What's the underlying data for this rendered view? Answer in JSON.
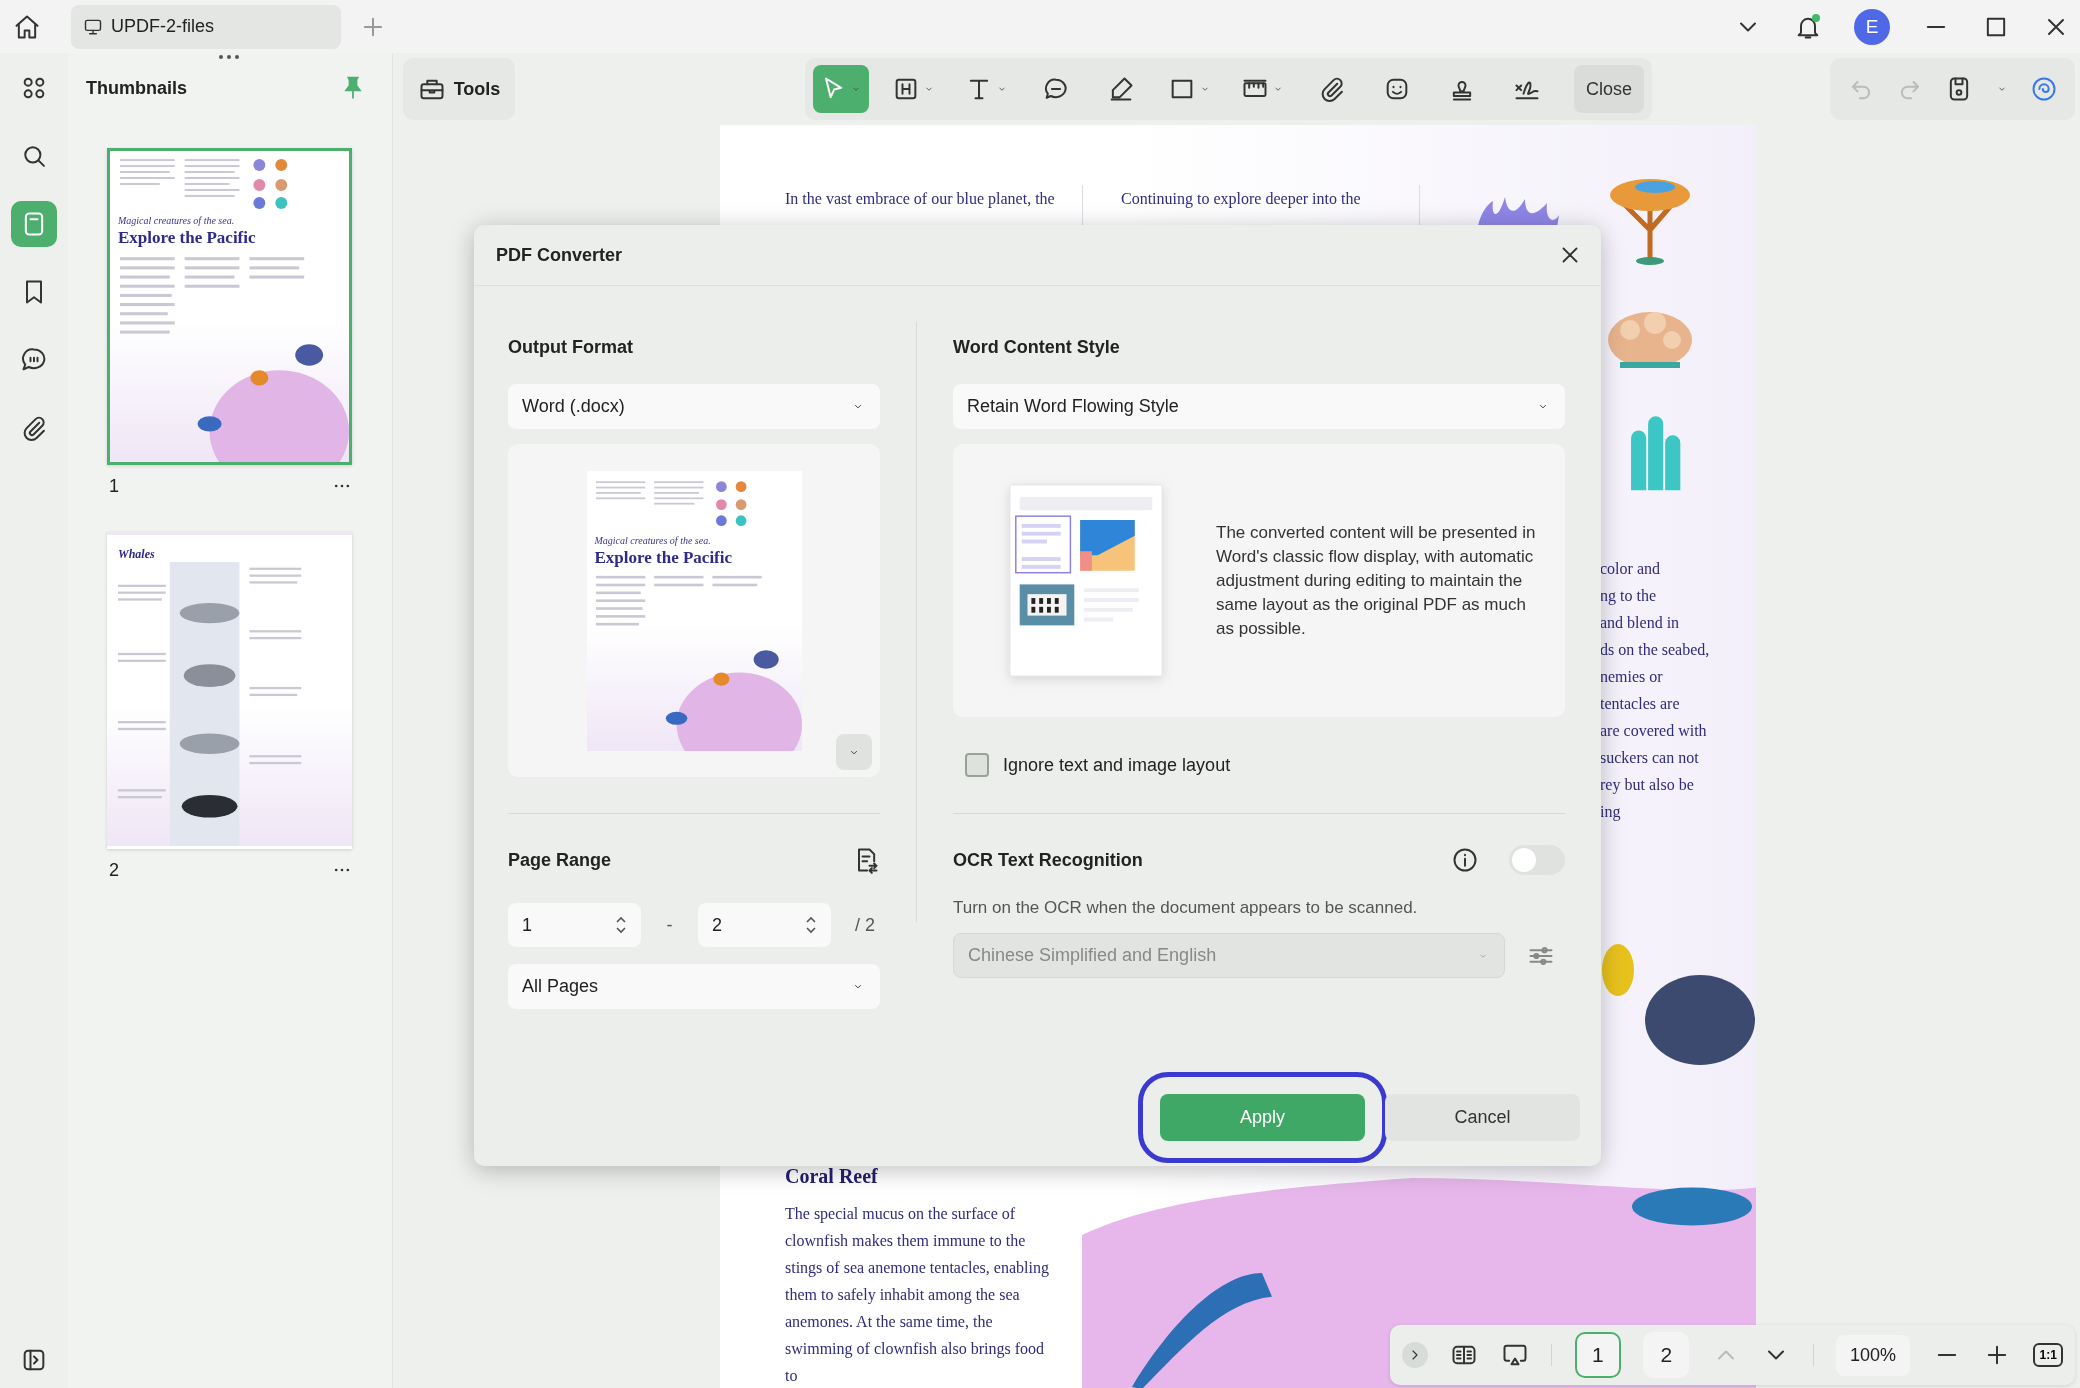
{
  "app": {
    "tab_title": "UPDF-2-files",
    "avatar_initial": "E",
    "notification_dot": true
  },
  "sidebar": {
    "items": [
      {
        "selected": false
      },
      {
        "selected": false
      },
      {
        "selected": true
      },
      {
        "selected": false
      },
      {
        "selected": false
      },
      {
        "selected": false
      }
    ]
  },
  "thumbnails": {
    "title": "Thumbnails",
    "pages": [
      {
        "number": "1",
        "selected": true,
        "kind": "pacific",
        "subtitle": "Magical creatures of the sea.",
        "heading": "Explore the Pacific"
      },
      {
        "number": "2",
        "selected": false,
        "kind": "whales",
        "heading": "Whales"
      }
    ]
  },
  "toolbar": {
    "tools_label": "Tools",
    "tools": [
      {
        "selected": true,
        "dropdown": true
      },
      {
        "selected": false,
        "dropdown": true
      },
      {
        "selected": false,
        "dropdown": true
      },
      {
        "selected": false,
        "dropdown": false
      },
      {
        "selected": false,
        "dropdown": false
      },
      {
        "selected": false,
        "dropdown": true
      },
      {
        "selected": false,
        "dropdown": true
      },
      {
        "selected": false,
        "dropdown": false
      },
      {
        "selected": false,
        "dropdown": false
      },
      {
        "selected": false,
        "dropdown": false
      },
      {
        "selected": false,
        "dropdown": false
      }
    ],
    "close_label": "Close",
    "undo": {
      "disabled": true
    },
    "redo": {
      "disabled": true
    }
  },
  "document": {
    "column_1": "In the vast embrace of our blue planet, the",
    "column_2": "Continuing to explore deeper into the",
    "column_3": [
      "color and",
      "ng to the",
      "and blend in",
      "ds on the seabed,",
      "nemies or",
      "tentacles are",
      "are covered with",
      "suckers can not",
      "rey but also be",
      "ing"
    ],
    "section": {
      "heading": "Coral Reef",
      "text": "The special mucus on the surface of clownfish makes them immune to the stings of sea anemone tentacles, enabling them to safely inhabit among the sea anemones. At the same time, the swimming of clownfish also brings food to"
    }
  },
  "dialog": {
    "title": "PDF Converter",
    "output_format": {
      "label": "Output Format",
      "value": "Word (.docx)"
    },
    "preview": {
      "subtitle": "Magical creatures of the sea.",
      "heading": "Explore the Pacific"
    },
    "page_range": {
      "label": "Page Range",
      "from": "1",
      "separator": "-",
      "to": "2",
      "total": "/ 2",
      "preset": "All Pages"
    },
    "content_style": {
      "label": "Word Content Style",
      "value": "Retain Word Flowing Style",
      "description": "The converted content will be presented in Word's classic flow display, with automatic adjustment during editing to maintain the same layout as the original PDF as much as possible."
    },
    "ignore_layout": {
      "label": "Ignore text and image layout",
      "checked": false
    },
    "ocr": {
      "label": "OCR Text Recognition",
      "on": false,
      "hint": "Turn on the OCR when the document appears to be scanned.",
      "language": "Chinese Simplified and English",
      "disabled": true
    },
    "buttons": [
      {
        "label": "Apply",
        "kind": "primary",
        "highlighted": true
      },
      {
        "label": "Cancel",
        "kind": "secondary",
        "highlighted": false
      }
    ]
  },
  "status_bar": {
    "pages": [
      {
        "label": "1",
        "selected": true
      },
      {
        "label": "2",
        "selected": false
      }
    ],
    "prev_disabled": true,
    "zoom": "100%",
    "actual_size": "1:1"
  }
}
